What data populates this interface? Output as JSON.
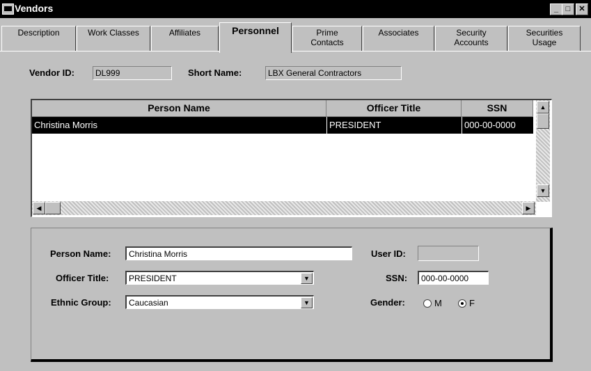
{
  "window": {
    "title": "Vendors",
    "min": "_",
    "max": "□",
    "close": "✕"
  },
  "tabs": [
    {
      "label": "Description"
    },
    {
      "label": "Work Classes"
    },
    {
      "label": "Affiliates"
    },
    {
      "label": "Personnel"
    },
    {
      "label": "Prime\nContacts"
    },
    {
      "label": "Associates"
    },
    {
      "label": "Security\nAccounts"
    },
    {
      "label": "Securities\nUsage"
    }
  ],
  "header": {
    "vendor_id_label": "Vendor ID:",
    "vendor_id_value": "DL999",
    "short_name_label": "Short Name:",
    "short_name_value": "LBX General Contractors"
  },
  "grid": {
    "columns": [
      "Person Name",
      "Officer Title",
      "SSN"
    ],
    "rows": [
      {
        "name": "Christina Morris",
        "title": "PRESIDENT",
        "ssn": "000-00-0000"
      }
    ]
  },
  "scroll": {
    "up": "▲",
    "down": "▼",
    "left": "◀",
    "right": "▶"
  },
  "detail": {
    "person_name_label": "Person Name:",
    "person_name_value": "Christina Morris",
    "officer_title_label": "Officer Title:",
    "officer_title_value": "PRESIDENT",
    "ethnic_group_label": "Ethnic Group:",
    "ethnic_group_value": "Caucasian",
    "user_id_label": "User ID:",
    "user_id_value": "",
    "ssn_label": "SSN:",
    "ssn_value": "000-00-0000",
    "gender_label": "Gender:",
    "gender_options": [
      "M",
      "F"
    ],
    "gender_selected": "F",
    "combo_arrow": "▼"
  }
}
